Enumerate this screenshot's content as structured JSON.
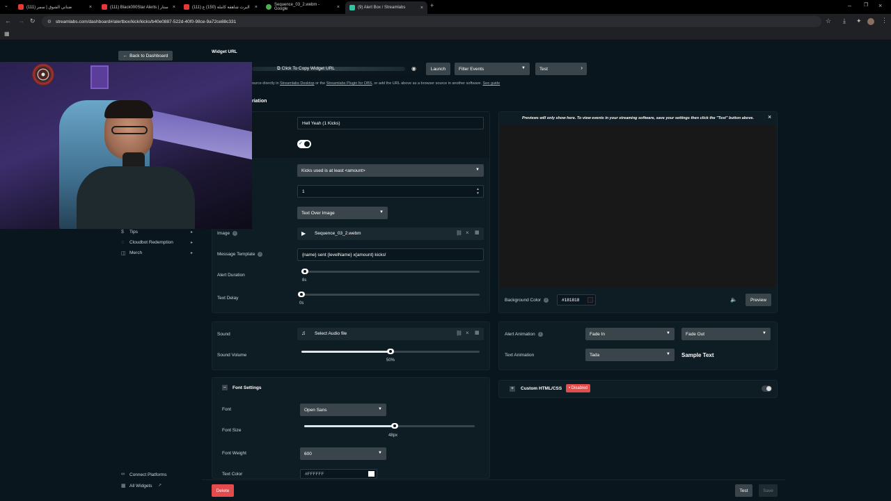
{
  "browser": {
    "tabs": [
      {
        "title": "(111) ضناني الشوق | سمر",
        "color": "#e53935"
      },
      {
        "title": "(111) Black000Star Alerts | ستار",
        "color": "#e53935"
      },
      {
        "title": "(111) البرث شاهقة كاملة (150) ع",
        "color": "#e53935"
      },
      {
        "title": "Sequence_03_2.webm - Google",
        "color": "#4caf50"
      },
      {
        "title": "(9) Alert Box / Streamlabs",
        "color": "#31c3a2"
      }
    ],
    "url": "streamlabs.com/dashboard#/alertbox/kick/kicks/b40e0887-522d-40f0-98ce-9a72ce88c331"
  },
  "sidebar": {
    "back_label": "Back to Dashboard",
    "items": [
      {
        "label": "Tips"
      },
      {
        "label": "Cloudbot Redemption"
      },
      {
        "label": "Merch"
      }
    ],
    "connect_label": "Connect Platforms",
    "all_widgets_label": "All Widgets"
  },
  "widget_url": {
    "heading": "Widget URL",
    "copy_label": "Click To Copy Widget URL",
    "launch_label": "Launch",
    "filter_label": "Filter Events",
    "test_label": "Test",
    "help_text_1": "ource directly in ",
    "help_link_1": "Streamlabs Desktop",
    "help_text_2": " or the ",
    "help_link_2": "Streamlabs Plugin for OBS",
    "help_text_3": ", or add the URL above as a browser source in another software. ",
    "help_link_3": "See guide"
  },
  "variation": {
    "heading": "riation",
    "name_value": "Hell Yeah (1 Kicks)",
    "condition_value": "Kicks used is at least <amount>",
    "amount_value": "1",
    "layout_value": "Text Over Image",
    "image_label": "Image",
    "image_file": "Sequence_03_2.webm",
    "message_label": "Message Template",
    "message_value": "{name} sent {levelName} x{amount} kicks!",
    "duration_label": "Alert Duration",
    "duration_value": "8s",
    "duration_fraction": 0.02,
    "delay_label": "Text Delay",
    "delay_value": "0s",
    "delay_fraction": 0.0
  },
  "preview": {
    "notice": "Previews will only show here. To view events in your streaming software, save your settings then click the \"Test\" button above.",
    "bg_label": "Background Color",
    "bg_value": "#181818",
    "preview_label": "Preview"
  },
  "sound": {
    "label": "Sound",
    "file": "Select Audio file",
    "volume_label": "Sound Volume",
    "volume_value": "50%",
    "volume_fraction": 0.5
  },
  "animation": {
    "alert_label": "Alert Animation",
    "in_value": "Fade In",
    "out_value": "Fade Out",
    "text_label": "Text Animation",
    "text_value": "Tada",
    "sample_label": "Sample Text"
  },
  "font": {
    "heading": "Font Settings",
    "font_label": "Font",
    "font_value": "Open Sans",
    "size_label": "Font Size",
    "size_value": "48px",
    "size_fraction": 0.53,
    "weight_label": "Font Weight",
    "weight_value": "600",
    "color_label": "Text Color",
    "color_value": "#FFFFFF"
  },
  "custom_css": {
    "label": "Custom HTML/CSS",
    "badge": "• Disabled"
  },
  "footer": {
    "delete_label": "Delete",
    "test_label": "Test",
    "save_label": "Save"
  },
  "colors": {
    "accent": "#31c3a2",
    "danger": "#e34c4c",
    "background": "#09161d"
  }
}
